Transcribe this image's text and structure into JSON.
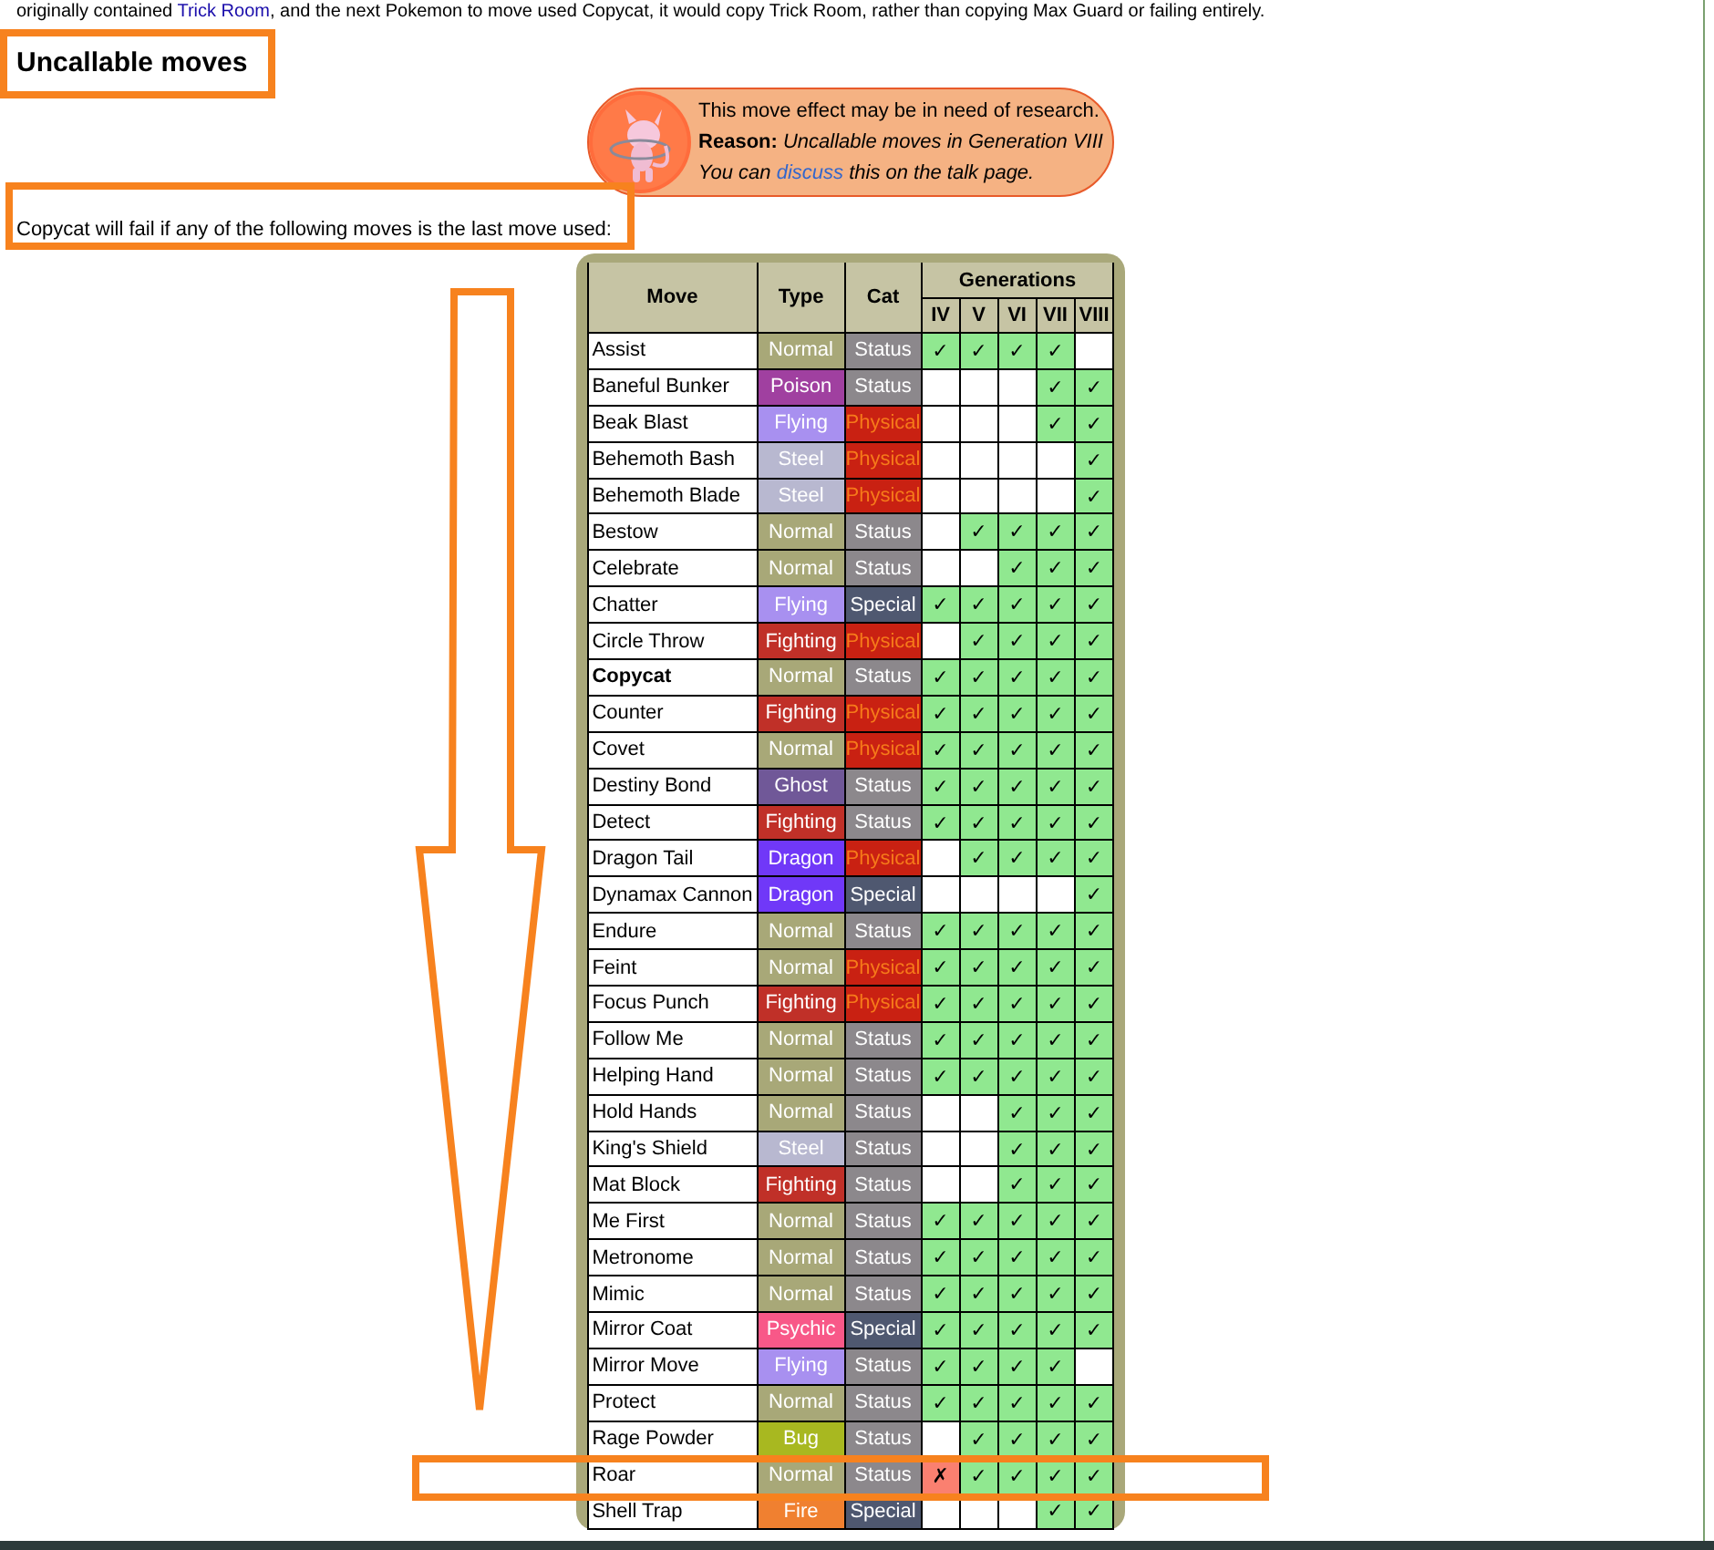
{
  "intro_before": "originally contained",
  "intro_link": "Trick Room",
  "intro_after": ", and the next Pokemon to move used Copycat, it would copy Trick Room, rather than copying Max Guard or failing entirely.",
  "heading": "Uncallable moves",
  "research_notice": {
    "line1": "This move effect may be in need of research.",
    "reason_label": "Reason:",
    "reason": "Uncallable moves in Generation VIII",
    "talk_before": "You can",
    "talk_link": "discuss",
    "talk_after": "this on the talk page."
  },
  "lead_text": "Copycat will fail if any of the following moves is the last move used:",
  "table": {
    "columns": [
      "Move",
      "Type",
      "Cat"
    ],
    "generations_label": "Generations",
    "generations": [
      "IV",
      "V",
      "VI",
      "VII",
      "VIII"
    ],
    "rows": [
      {
        "move": "Assist",
        "bold": false,
        "type": {
          "label": "Normal",
          "color": "#a8a878"
        },
        "cat": {
          "label": "Status",
          "kind": "status"
        },
        "gens": [
          {
            "kind": "yes",
            "mark": "✓"
          },
          {
            "kind": "yes",
            "mark": "✓"
          },
          {
            "kind": "yes",
            "mark": "✓"
          },
          {
            "kind": "yes",
            "mark": "✓"
          },
          {
            "kind": "no"
          }
        ]
      },
      {
        "move": "Baneful Bunker",
        "bold": false,
        "type": {
          "label": "Poison",
          "color": "#a040a0"
        },
        "cat": {
          "label": "Status",
          "kind": "status"
        },
        "gens": [
          {
            "kind": "no"
          },
          {
            "kind": "no"
          },
          {
            "kind": "no"
          },
          {
            "kind": "yes",
            "mark": "✓"
          },
          {
            "kind": "yes",
            "mark": "✓"
          }
        ]
      },
      {
        "move": "Beak Blast",
        "bold": false,
        "type": {
          "label": "Flying",
          "color": "#a890f0"
        },
        "cat": {
          "label": "Physical",
          "kind": "physical"
        },
        "gens": [
          {
            "kind": "no"
          },
          {
            "kind": "no"
          },
          {
            "kind": "no"
          },
          {
            "kind": "yes",
            "mark": "✓"
          },
          {
            "kind": "yes",
            "mark": "✓"
          }
        ]
      },
      {
        "move": "Behemoth Bash",
        "bold": false,
        "type": {
          "label": "Steel",
          "color": "#b8b8d0"
        },
        "cat": {
          "label": "Physical",
          "kind": "physical"
        },
        "gens": [
          {
            "kind": "no"
          },
          {
            "kind": "no"
          },
          {
            "kind": "no"
          },
          {
            "kind": "no"
          },
          {
            "kind": "yes",
            "mark": "✓"
          }
        ]
      },
      {
        "move": "Behemoth Blade",
        "bold": false,
        "type": {
          "label": "Steel",
          "color": "#b8b8d0"
        },
        "cat": {
          "label": "Physical",
          "kind": "physical"
        },
        "gens": [
          {
            "kind": "no"
          },
          {
            "kind": "no"
          },
          {
            "kind": "no"
          },
          {
            "kind": "no"
          },
          {
            "kind": "yes",
            "mark": "✓"
          }
        ]
      },
      {
        "move": "Bestow",
        "bold": false,
        "type": {
          "label": "Normal",
          "color": "#a8a878"
        },
        "cat": {
          "label": "Status",
          "kind": "status"
        },
        "gens": [
          {
            "kind": "no"
          },
          {
            "kind": "yes",
            "mark": "✓"
          },
          {
            "kind": "yes",
            "mark": "✓"
          },
          {
            "kind": "yes",
            "mark": "✓"
          },
          {
            "kind": "yes",
            "mark": "✓"
          }
        ]
      },
      {
        "move": "Celebrate",
        "bold": false,
        "type": {
          "label": "Normal",
          "color": "#a8a878"
        },
        "cat": {
          "label": "Status",
          "kind": "status"
        },
        "gens": [
          {
            "kind": "no"
          },
          {
            "kind": "no"
          },
          {
            "kind": "yes",
            "mark": "✓"
          },
          {
            "kind": "yes",
            "mark": "✓"
          },
          {
            "kind": "yes",
            "mark": "✓"
          }
        ]
      },
      {
        "move": "Chatter",
        "bold": false,
        "type": {
          "label": "Flying",
          "color": "#a890f0"
        },
        "cat": {
          "label": "Special",
          "kind": "special"
        },
        "gens": [
          {
            "kind": "yes",
            "mark": "✓"
          },
          {
            "kind": "yes",
            "mark": "✓"
          },
          {
            "kind": "yes",
            "mark": "✓"
          },
          {
            "kind": "yes",
            "mark": "✓"
          },
          {
            "kind": "yes",
            "mark": "✓"
          }
        ]
      },
      {
        "move": "Circle Throw",
        "bold": false,
        "type": {
          "label": "Fighting",
          "color": "#c03028"
        },
        "cat": {
          "label": "Physical",
          "kind": "physical"
        },
        "gens": [
          {
            "kind": "no"
          },
          {
            "kind": "yes",
            "mark": "✓"
          },
          {
            "kind": "yes",
            "mark": "✓"
          },
          {
            "kind": "yes",
            "mark": "✓"
          },
          {
            "kind": "yes",
            "mark": "✓"
          }
        ]
      },
      {
        "move": "Copycat",
        "bold": true,
        "type": {
          "label": "Normal",
          "color": "#a8a878"
        },
        "cat": {
          "label": "Status",
          "kind": "status"
        },
        "gens": [
          {
            "kind": "yes",
            "mark": "✓"
          },
          {
            "kind": "yes",
            "mark": "✓"
          },
          {
            "kind": "yes",
            "mark": "✓"
          },
          {
            "kind": "yes",
            "mark": "✓"
          },
          {
            "kind": "yes",
            "mark": "✓"
          }
        ]
      },
      {
        "move": "Counter",
        "bold": false,
        "type": {
          "label": "Fighting",
          "color": "#c03028"
        },
        "cat": {
          "label": "Physical",
          "kind": "physical"
        },
        "gens": [
          {
            "kind": "yes",
            "mark": "✓"
          },
          {
            "kind": "yes",
            "mark": "✓"
          },
          {
            "kind": "yes",
            "mark": "✓"
          },
          {
            "kind": "yes",
            "mark": "✓"
          },
          {
            "kind": "yes",
            "mark": "✓"
          }
        ]
      },
      {
        "move": "Covet",
        "bold": false,
        "type": {
          "label": "Normal",
          "color": "#a8a878"
        },
        "cat": {
          "label": "Physical",
          "kind": "physical"
        },
        "gens": [
          {
            "kind": "yes",
            "mark": "✓"
          },
          {
            "kind": "yes",
            "mark": "✓"
          },
          {
            "kind": "yes",
            "mark": "✓"
          },
          {
            "kind": "yes",
            "mark": "✓"
          },
          {
            "kind": "yes",
            "mark": "✓"
          }
        ]
      },
      {
        "move": "Destiny Bond",
        "bold": false,
        "type": {
          "label": "Ghost",
          "color": "#705898"
        },
        "cat": {
          "label": "Status",
          "kind": "status"
        },
        "gens": [
          {
            "kind": "yes",
            "mark": "✓"
          },
          {
            "kind": "yes",
            "mark": "✓"
          },
          {
            "kind": "yes",
            "mark": "✓"
          },
          {
            "kind": "yes",
            "mark": "✓"
          },
          {
            "kind": "yes",
            "mark": "✓"
          }
        ]
      },
      {
        "move": "Detect",
        "bold": false,
        "type": {
          "label": "Fighting",
          "color": "#c03028"
        },
        "cat": {
          "label": "Status",
          "kind": "status"
        },
        "gens": [
          {
            "kind": "yes",
            "mark": "✓"
          },
          {
            "kind": "yes",
            "mark": "✓"
          },
          {
            "kind": "yes",
            "mark": "✓"
          },
          {
            "kind": "yes",
            "mark": "✓"
          },
          {
            "kind": "yes",
            "mark": "✓"
          }
        ]
      },
      {
        "move": "Dragon Tail",
        "bold": false,
        "type": {
          "label": "Dragon",
          "color": "#7038f8"
        },
        "cat": {
          "label": "Physical",
          "kind": "physical"
        },
        "gens": [
          {
            "kind": "no"
          },
          {
            "kind": "yes",
            "mark": "✓"
          },
          {
            "kind": "yes",
            "mark": "✓"
          },
          {
            "kind": "yes",
            "mark": "✓"
          },
          {
            "kind": "yes",
            "mark": "✓"
          }
        ]
      },
      {
        "move": "Dynamax Cannon",
        "bold": false,
        "type": {
          "label": "Dragon",
          "color": "#7038f8"
        },
        "cat": {
          "label": "Special",
          "kind": "special"
        },
        "gens": [
          {
            "kind": "no"
          },
          {
            "kind": "no"
          },
          {
            "kind": "no"
          },
          {
            "kind": "no"
          },
          {
            "kind": "yes",
            "mark": "✓"
          }
        ]
      },
      {
        "move": "Endure",
        "bold": false,
        "type": {
          "label": "Normal",
          "color": "#a8a878"
        },
        "cat": {
          "label": "Status",
          "kind": "status"
        },
        "gens": [
          {
            "kind": "yes",
            "mark": "✓"
          },
          {
            "kind": "yes",
            "mark": "✓"
          },
          {
            "kind": "yes",
            "mark": "✓"
          },
          {
            "kind": "yes",
            "mark": "✓"
          },
          {
            "kind": "yes",
            "mark": "✓"
          }
        ]
      },
      {
        "move": "Feint",
        "bold": false,
        "type": {
          "label": "Normal",
          "color": "#a8a878"
        },
        "cat": {
          "label": "Physical",
          "kind": "physical"
        },
        "gens": [
          {
            "kind": "yes",
            "mark": "✓"
          },
          {
            "kind": "yes",
            "mark": "✓"
          },
          {
            "kind": "yes",
            "mark": "✓"
          },
          {
            "kind": "yes",
            "mark": "✓"
          },
          {
            "kind": "yes",
            "mark": "✓"
          }
        ]
      },
      {
        "move": "Focus Punch",
        "bold": false,
        "type": {
          "label": "Fighting",
          "color": "#c03028"
        },
        "cat": {
          "label": "Physical",
          "kind": "physical"
        },
        "gens": [
          {
            "kind": "yes",
            "mark": "✓"
          },
          {
            "kind": "yes",
            "mark": "✓"
          },
          {
            "kind": "yes",
            "mark": "✓"
          },
          {
            "kind": "yes",
            "mark": "✓"
          },
          {
            "kind": "yes",
            "mark": "✓"
          }
        ]
      },
      {
        "move": "Follow Me",
        "bold": false,
        "type": {
          "label": "Normal",
          "color": "#a8a878"
        },
        "cat": {
          "label": "Status",
          "kind": "status"
        },
        "gens": [
          {
            "kind": "yes",
            "mark": "✓"
          },
          {
            "kind": "yes",
            "mark": "✓"
          },
          {
            "kind": "yes",
            "mark": "✓"
          },
          {
            "kind": "yes",
            "mark": "✓"
          },
          {
            "kind": "yes",
            "mark": "✓"
          }
        ]
      },
      {
        "move": "Helping Hand",
        "bold": false,
        "type": {
          "label": "Normal",
          "color": "#a8a878"
        },
        "cat": {
          "label": "Status",
          "kind": "status"
        },
        "gens": [
          {
            "kind": "yes",
            "mark": "✓"
          },
          {
            "kind": "yes",
            "mark": "✓"
          },
          {
            "kind": "yes",
            "mark": "✓"
          },
          {
            "kind": "yes",
            "mark": "✓"
          },
          {
            "kind": "yes",
            "mark": "✓"
          }
        ]
      },
      {
        "move": "Hold Hands",
        "bold": false,
        "type": {
          "label": "Normal",
          "color": "#a8a878"
        },
        "cat": {
          "label": "Status",
          "kind": "status"
        },
        "gens": [
          {
            "kind": "no"
          },
          {
            "kind": "no"
          },
          {
            "kind": "yes",
            "mark": "✓"
          },
          {
            "kind": "yes",
            "mark": "✓"
          },
          {
            "kind": "yes",
            "mark": "✓"
          }
        ]
      },
      {
        "move": "King's Shield",
        "bold": false,
        "type": {
          "label": "Steel",
          "color": "#b8b8d0"
        },
        "cat": {
          "label": "Status",
          "kind": "status"
        },
        "gens": [
          {
            "kind": "no"
          },
          {
            "kind": "no"
          },
          {
            "kind": "yes",
            "mark": "✓"
          },
          {
            "kind": "yes",
            "mark": "✓"
          },
          {
            "kind": "yes",
            "mark": "✓"
          }
        ]
      },
      {
        "move": "Mat Block",
        "bold": false,
        "type": {
          "label": "Fighting",
          "color": "#c03028"
        },
        "cat": {
          "label": "Status",
          "kind": "status"
        },
        "gens": [
          {
            "kind": "no"
          },
          {
            "kind": "no"
          },
          {
            "kind": "yes",
            "mark": "✓"
          },
          {
            "kind": "yes",
            "mark": "✓"
          },
          {
            "kind": "yes",
            "mark": "✓"
          }
        ]
      },
      {
        "move": "Me First",
        "bold": false,
        "type": {
          "label": "Normal",
          "color": "#a8a878"
        },
        "cat": {
          "label": "Status",
          "kind": "status"
        },
        "gens": [
          {
            "kind": "yes",
            "mark": "✓"
          },
          {
            "kind": "yes",
            "mark": "✓"
          },
          {
            "kind": "yes",
            "mark": "✓"
          },
          {
            "kind": "yes",
            "mark": "✓"
          },
          {
            "kind": "yes",
            "mark": "✓"
          }
        ]
      },
      {
        "move": "Metronome",
        "bold": false,
        "type": {
          "label": "Normal",
          "color": "#a8a878"
        },
        "cat": {
          "label": "Status",
          "kind": "status"
        },
        "gens": [
          {
            "kind": "yes",
            "mark": "✓"
          },
          {
            "kind": "yes",
            "mark": "✓"
          },
          {
            "kind": "yes",
            "mark": "✓"
          },
          {
            "kind": "yes",
            "mark": "✓"
          },
          {
            "kind": "yes",
            "mark": "✓"
          }
        ]
      },
      {
        "move": "Mimic",
        "bold": false,
        "type": {
          "label": "Normal",
          "color": "#a8a878"
        },
        "cat": {
          "label": "Status",
          "kind": "status"
        },
        "gens": [
          {
            "kind": "yes",
            "mark": "✓"
          },
          {
            "kind": "yes",
            "mark": "✓"
          },
          {
            "kind": "yes",
            "mark": "✓"
          },
          {
            "kind": "yes",
            "mark": "✓"
          },
          {
            "kind": "yes",
            "mark": "✓"
          }
        ]
      },
      {
        "move": "Mirror Coat",
        "bold": false,
        "type": {
          "label": "Psychic",
          "color": "#f85888"
        },
        "cat": {
          "label": "Special",
          "kind": "special"
        },
        "gens": [
          {
            "kind": "yes",
            "mark": "✓"
          },
          {
            "kind": "yes",
            "mark": "✓"
          },
          {
            "kind": "yes",
            "mark": "✓"
          },
          {
            "kind": "yes",
            "mark": "✓"
          },
          {
            "kind": "yes",
            "mark": "✓"
          }
        ]
      },
      {
        "move": "Mirror Move",
        "bold": false,
        "type": {
          "label": "Flying",
          "color": "#a890f0"
        },
        "cat": {
          "label": "Status",
          "kind": "status"
        },
        "gens": [
          {
            "kind": "yes",
            "mark": "✓"
          },
          {
            "kind": "yes",
            "mark": "✓"
          },
          {
            "kind": "yes",
            "mark": "✓"
          },
          {
            "kind": "yes",
            "mark": "✓"
          },
          {
            "kind": "no"
          }
        ]
      },
      {
        "move": "Protect",
        "bold": false,
        "type": {
          "label": "Normal",
          "color": "#a8a878"
        },
        "cat": {
          "label": "Status",
          "kind": "status"
        },
        "gens": [
          {
            "kind": "yes",
            "mark": "✓"
          },
          {
            "kind": "yes",
            "mark": "✓"
          },
          {
            "kind": "yes",
            "mark": "✓"
          },
          {
            "kind": "yes",
            "mark": "✓"
          },
          {
            "kind": "yes",
            "mark": "✓"
          }
        ]
      },
      {
        "move": "Rage Powder",
        "bold": false,
        "type": {
          "label": "Bug",
          "color": "#a8b820"
        },
        "cat": {
          "label": "Status",
          "kind": "status"
        },
        "gens": [
          {
            "kind": "no"
          },
          {
            "kind": "yes",
            "mark": "✓"
          },
          {
            "kind": "yes",
            "mark": "✓"
          },
          {
            "kind": "yes",
            "mark": "✓"
          },
          {
            "kind": "yes",
            "mark": "✓"
          }
        ]
      },
      {
        "move": "Roar",
        "bold": false,
        "type": {
          "label": "Normal",
          "color": "#a8a878"
        },
        "cat": {
          "label": "Status",
          "kind": "status"
        },
        "gens": [
          {
            "kind": "fail",
            "mark": "✗"
          },
          {
            "kind": "yes",
            "mark": "✓"
          },
          {
            "kind": "yes",
            "mark": "✓"
          },
          {
            "kind": "yes",
            "mark": "✓"
          },
          {
            "kind": "yes",
            "mark": "✓"
          }
        ]
      },
      {
        "move": "Shell Trap",
        "bold": false,
        "type": {
          "label": "Fire",
          "color": "#f08030"
        },
        "cat": {
          "label": "Special",
          "kind": "special"
        },
        "gens": [
          {
            "kind": "no"
          },
          {
            "kind": "no"
          },
          {
            "kind": "no"
          },
          {
            "kind": "yes",
            "mark": "✓"
          },
          {
            "kind": "yes",
            "mark": "✓"
          }
        ]
      }
    ]
  }
}
